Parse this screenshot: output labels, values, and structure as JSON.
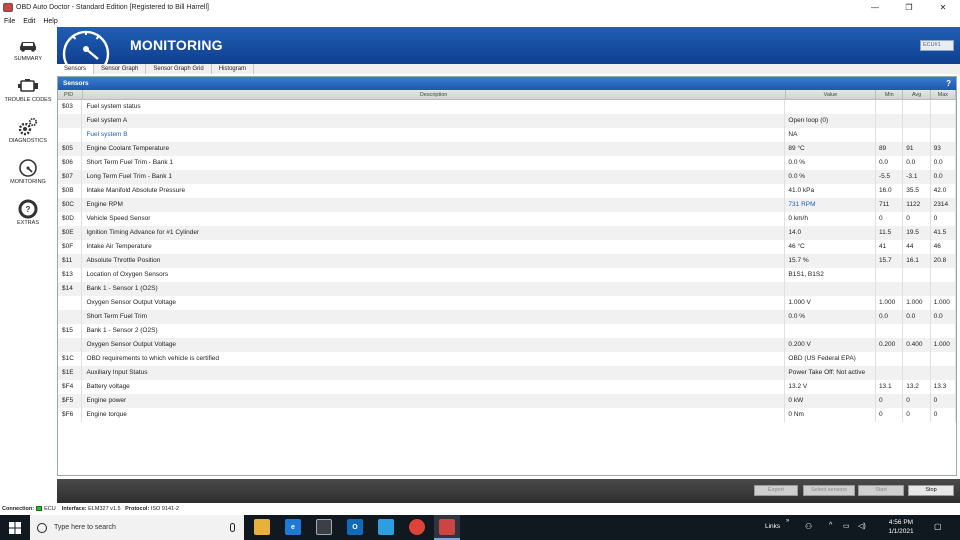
{
  "window": {
    "title": "OBD Auto Doctor - Standard Edition [Registered to Bill Harrell]",
    "controls": [
      "—",
      "❐",
      "✕"
    ]
  },
  "menu": [
    "File",
    "Edit",
    "Help"
  ],
  "nav": [
    {
      "label": "SUMMARY",
      "icon": "car-icon"
    },
    {
      "label": "TROUBLE CODES",
      "icon": "engine-icon"
    },
    {
      "label": "DIAGNOSTICS",
      "icon": "gears-icon"
    },
    {
      "label": "MONITORING",
      "icon": "gauge-icon"
    },
    {
      "label": "EXTRAS",
      "icon": "lifebuoy-icon"
    }
  ],
  "header": {
    "title": "MONITORING",
    "ecu": "ECU#1"
  },
  "tabs": [
    "Sensors",
    "Sensor Graph",
    "Sensor Graph Grid",
    "Histogram"
  ],
  "panel": {
    "title": "Sensors",
    "help": "?"
  },
  "columns": {
    "pid": "PID",
    "desc": "Description",
    "value": "Value",
    "min": "Min",
    "avg": "Avg",
    "max": "Max"
  },
  "rows": [
    {
      "pid": "$03",
      "desc": "Fuel system status",
      "value": "",
      "min": "",
      "avg": "",
      "max": ""
    },
    {
      "pid": "",
      "desc": "Fuel system A",
      "value": "Open loop (0)",
      "min": "",
      "avg": "",
      "max": ""
    },
    {
      "pid": "",
      "desc": "Fuel system B",
      "value": "NA",
      "min": "",
      "avg": "",
      "max": ""
    },
    {
      "pid": "$05",
      "desc": "Engine Coolant Temperature",
      "value": "89 °C",
      "min": "89",
      "avg": "91",
      "max": "93"
    },
    {
      "pid": "$06",
      "desc": "Short Term Fuel Trim - Bank 1",
      "value": "0.0 %",
      "min": "0.0",
      "avg": "0.0",
      "max": "0.0"
    },
    {
      "pid": "$07",
      "desc": "Long Term Fuel Trim - Bank 1",
      "value": "0.0 %",
      "min": "-5.5",
      "avg": "-3.1",
      "max": "0.0"
    },
    {
      "pid": "$0B",
      "desc": "Intake Manifold Absolute Pressure",
      "value": "41.0 kPa",
      "min": "16.0",
      "avg": "35.5",
      "max": "42.0"
    },
    {
      "pid": "$0C",
      "desc": "Engine RPM",
      "value": "731 RPM",
      "min": "711",
      "avg": "1122",
      "max": "2314"
    },
    {
      "pid": "$0D",
      "desc": "Vehicle Speed Sensor",
      "value": "0 km/h",
      "min": "0",
      "avg": "0",
      "max": "0"
    },
    {
      "pid": "$0E",
      "desc": "Ignition Timing Advance for #1 Cylinder",
      "value": "14.0",
      "min": "11.5",
      "avg": "19.5",
      "max": "41.5"
    },
    {
      "pid": "$0F",
      "desc": "Intake Air Temperature",
      "value": "46 °C",
      "min": "41",
      "avg": "44",
      "max": "46"
    },
    {
      "pid": "$11",
      "desc": "Absolute Throttle Position",
      "value": "15.7 %",
      "min": "15.7",
      "avg": "16.1",
      "max": "20.8"
    },
    {
      "pid": "$13",
      "desc": "Location of Oxygen Sensors",
      "value": "B1S1, B1S2",
      "min": "",
      "avg": "",
      "max": ""
    },
    {
      "pid": "$14",
      "desc": "Bank 1 - Sensor 1 (O2S)",
      "value": "",
      "min": "",
      "avg": "",
      "max": ""
    },
    {
      "pid": "",
      "desc": "Oxygen Sensor Output Voltage",
      "value": "1.000 V",
      "min": "1.000",
      "avg": "1.000",
      "max": "1.000"
    },
    {
      "pid": "",
      "desc": "Short Term Fuel Trim",
      "value": "0.0 %",
      "min": "0.0",
      "avg": "0.0",
      "max": "0.0"
    },
    {
      "pid": "$15",
      "desc": "Bank 1 - Sensor 2 (O2S)",
      "value": "",
      "min": "",
      "avg": "",
      "max": ""
    },
    {
      "pid": "",
      "desc": "Oxygen Sensor Output Voltage",
      "value": "0.200 V",
      "min": "0.200",
      "avg": "0.400",
      "max": "1.000"
    },
    {
      "pid": "$1C",
      "desc": "OBD requirements to which vehicle is certified",
      "value": "OBD (US Federal EPA)",
      "min": "",
      "avg": "",
      "max": ""
    },
    {
      "pid": "$1E",
      "desc": "Auxiliary Input Status",
      "value": "Power Take Off: Not active",
      "min": "",
      "avg": "",
      "max": ""
    },
    {
      "pid": "$F4",
      "desc": "Battery voltage",
      "value": "13.2 V",
      "min": "13.1",
      "avg": "13.2",
      "max": "13.3"
    },
    {
      "pid": "$F5",
      "desc": "Engine power",
      "value": "0 kW",
      "min": "0",
      "avg": "0",
      "max": "0"
    },
    {
      "pid": "$F6",
      "desc": "Engine torque",
      "value": "0 Nm",
      "min": "0",
      "avg": "0",
      "max": "0"
    }
  ],
  "buttons": {
    "export": "Export",
    "select": "Select sensors",
    "start": "Start",
    "stop": "Stop"
  },
  "status": {
    "connection_label": "Connection:",
    "connection": "ECU",
    "interface_label": "Interface:",
    "interface": "ELM327 v1.5",
    "protocol_label": "Protocol:",
    "protocol": "ISO 9141-2"
  },
  "taskbar": {
    "search_placeholder": "Type here to search",
    "links": "Links",
    "time": "4:56 PM",
    "date": "1/1/2021"
  }
}
